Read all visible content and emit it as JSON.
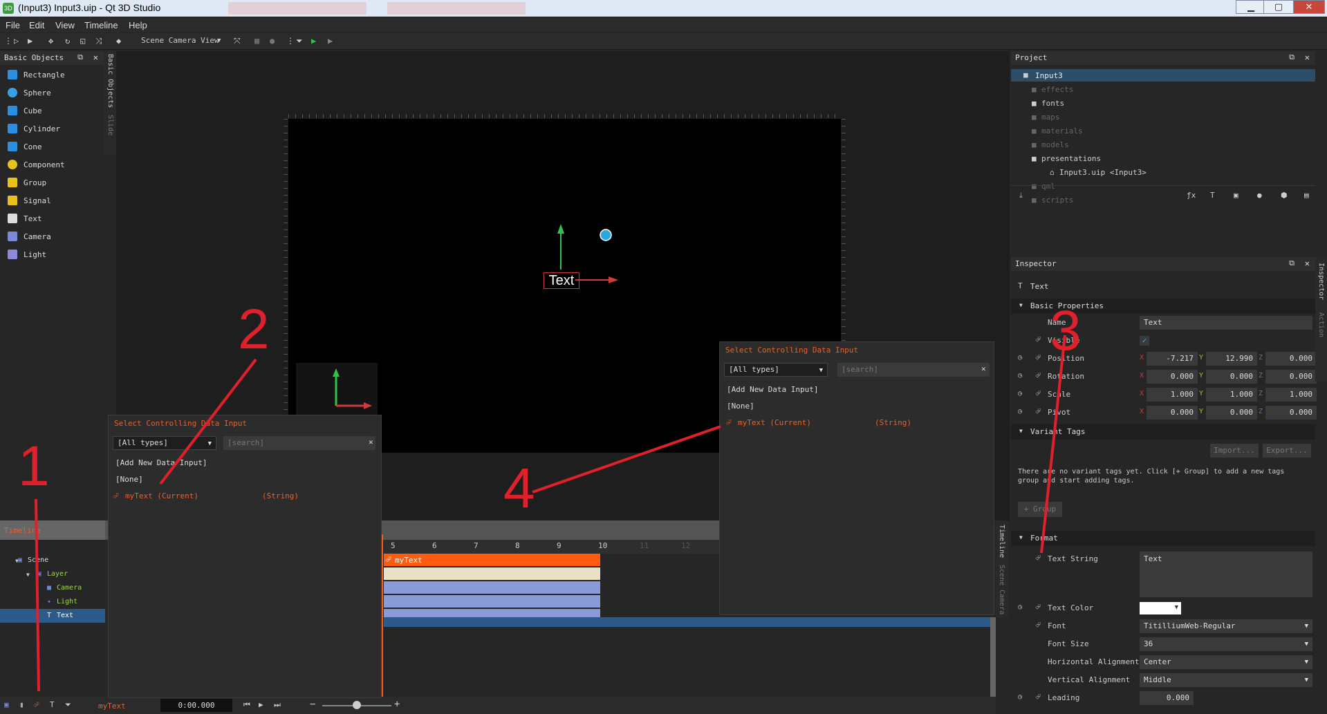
{
  "window": {
    "title": "(Input3) Input3.uip - Qt 3D Studio",
    "app_icon": "3D",
    "minimize": "▁",
    "maximize": "▢",
    "close": "✕"
  },
  "menu": [
    "File",
    "Edit",
    "View",
    "Timeline",
    "Help"
  ],
  "toolbar": {
    "camera_view": "Scene Camera View"
  },
  "basic_objects": {
    "title": "Basic Objects",
    "items": [
      {
        "label": "Rectangle",
        "color": "#2a8fe0"
      },
      {
        "label": "Sphere",
        "color": "#3ba0e6"
      },
      {
        "label": "Cube",
        "color": "#2a8fe0"
      },
      {
        "label": "Cylinder",
        "color": "#2a8fe0"
      },
      {
        "label": "Cone",
        "color": "#2a8fe0"
      },
      {
        "label": "Component",
        "color": "#e8c21a"
      },
      {
        "label": "Group",
        "color": "#e8c21a"
      },
      {
        "label": "Signal",
        "color": "#e8c21a"
      },
      {
        "label": "Text",
        "color": "#dddddd"
      },
      {
        "label": "Camera",
        "color": "#7a8ad8"
      },
      {
        "label": "Light",
        "color": "#8a8ad8"
      }
    ],
    "vertical_tabs": [
      "Basic Objects",
      "Slide"
    ]
  },
  "viewport": {
    "text_label": "Text"
  },
  "project": {
    "title": "Project",
    "root": "Input3",
    "items": [
      {
        "label": "effects",
        "dim": true
      },
      {
        "label": "fonts",
        "dim": false
      },
      {
        "label": "maps",
        "dim": true
      },
      {
        "label": "materials",
        "dim": true
      },
      {
        "label": "models",
        "dim": true
      },
      {
        "label": "presentations",
        "dim": false
      },
      {
        "label": "Input3.uip <Input3>",
        "dim": false
      },
      {
        "label": "qml",
        "dim": true
      },
      {
        "label": "scripts",
        "dim": true
      }
    ]
  },
  "inspector": {
    "title": "Inspector",
    "object": "Text",
    "vertical_tabs": [
      "Inspector",
      "Action"
    ],
    "basic_properties": "Basic Properties",
    "name_label": "Name",
    "name_value": "Text",
    "visible_label": "Visible",
    "position": {
      "label": "Position",
      "x": "-7.217",
      "y": "12.990",
      "z": "0.000"
    },
    "rotation": {
      "label": "Rotation",
      "x": "0.000",
      "y": "0.000",
      "z": "0.000"
    },
    "scale": {
      "label": "Scale",
      "x": "1.000",
      "y": "1.000",
      "z": "1.000"
    },
    "pivot": {
      "label": "Pivot",
      "x": "0.000",
      "y": "0.000",
      "z": "0.000"
    },
    "axis": {
      "x": "X",
      "y": "Y",
      "z": "Z"
    },
    "variant_tags": "Variant Tags",
    "import": "Import...",
    "export": "Export...",
    "variant_msg": "There are no variant tags yet. Click [+ Group] to add a new tags group and start adding tags.",
    "add_group": "+ Group",
    "format": "Format",
    "text_string_label": "Text String",
    "text_string_value": "Text",
    "text_color_label": "Text Color",
    "font_label": "Font",
    "font_value": "TitilliumWeb-Regular",
    "font_size_label": "Font Size",
    "font_size_value": "36",
    "halign_label": "Horizontal Alignment",
    "halign_value": "Center",
    "valign_label": "Vertical Alignment",
    "valign_value": "Middle",
    "leading_label": "Leading",
    "leading_value": "0.000"
  },
  "timeline": {
    "title": "Timeline",
    "rows": [
      "Scene",
      "Layer",
      "Camera",
      "Light",
      "Text"
    ],
    "ticks": [
      "5",
      "6",
      "7",
      "8",
      "9",
      "10",
      "11",
      "12"
    ],
    "bar_label": "myText",
    "vertical_tabs": [
      "Timeline",
      "Scene Camera"
    ]
  },
  "statusbar": {
    "data_input": "myText",
    "time": "0:00.000"
  },
  "popup_left": {
    "title": "Select Controlling Data Input",
    "type_filter": "[All types]",
    "search": "[search]",
    "add_new": "[Add New Data Input]",
    "none": "[None]",
    "item_name": "myText (Current)",
    "item_type": "(String)"
  },
  "popup_right": {
    "title": "Select Controlling Data Input",
    "type_filter": "[All types]",
    "search": "[search]",
    "add_new": "[Add New Data Input]",
    "none": "[None]",
    "item_name": "myText (Current)",
    "item_type": "(String)"
  },
  "annotations": [
    "1",
    "2",
    "3",
    "4"
  ]
}
